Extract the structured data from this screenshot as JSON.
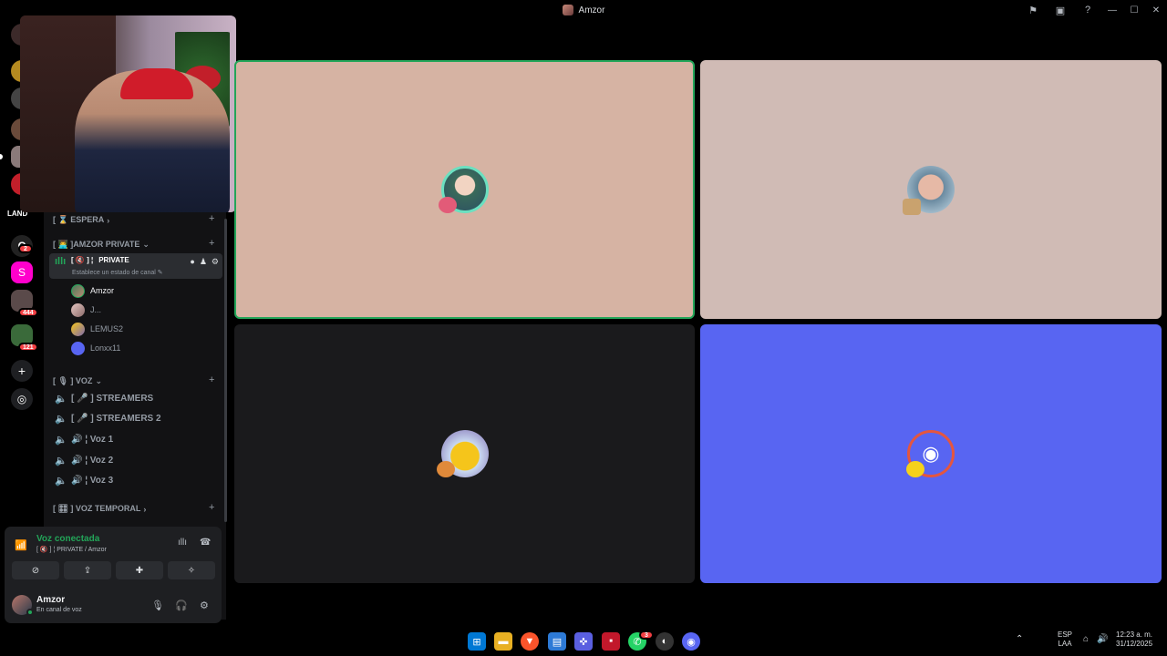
{
  "window": {
    "title": "Amzor"
  },
  "server_rail": {
    "badges": [
      "2",
      "444",
      "121"
    ],
    "land_label": "LAND",
    "s_label": "S"
  },
  "sidebar": {
    "categories": {
      "espera": "[ ⌛ ESPERA",
      "amzor_private": "[ 👨‍💻 ]AMZOR PRIVATE",
      "voz": "[ 🎙 ] VOZ",
      "voz_temporal": "[ 🎛 ] VOZ TEMPORAL"
    },
    "active_channel": {
      "prefix": "[ 🔇 ] ¦",
      "name": "PRIVATE",
      "status": "Establece un estado de canal"
    },
    "voice_users": [
      {
        "name": "Amzor"
      },
      {
        "name": "J..."
      },
      {
        "name": "LEMUS2"
      },
      {
        "name": "Lonxx11"
      }
    ],
    "voice_channels": [
      {
        "name": "[ 🎤 ] STREAMERS"
      },
      {
        "name": "[ 🎤 ] STREAMERS 2"
      },
      {
        "name": "🔊 ¦ Voz 1"
      },
      {
        "name": "🔊 ¦ Voz 2"
      },
      {
        "name": "🔊 ¦ Voz 3"
      }
    ]
  },
  "voice_panel": {
    "title": "Voz conectada",
    "subtitle": "[ 🔇 ] ¦ PRIVATE / Amzor"
  },
  "user_panel": {
    "name": "Amzor",
    "status": "En canal de voz"
  },
  "taskbar": {
    "lang_top": "ESP",
    "lang_bottom": "LAA",
    "time": "12:23 a. m.",
    "date": "31/12/2025",
    "badge_whatsapp": "3"
  },
  "colors": {
    "accent_green": "#23a559",
    "blurple": "#5865f2",
    "sidebar_bg": "#121214",
    "panel_bg": "#1e1f22"
  }
}
